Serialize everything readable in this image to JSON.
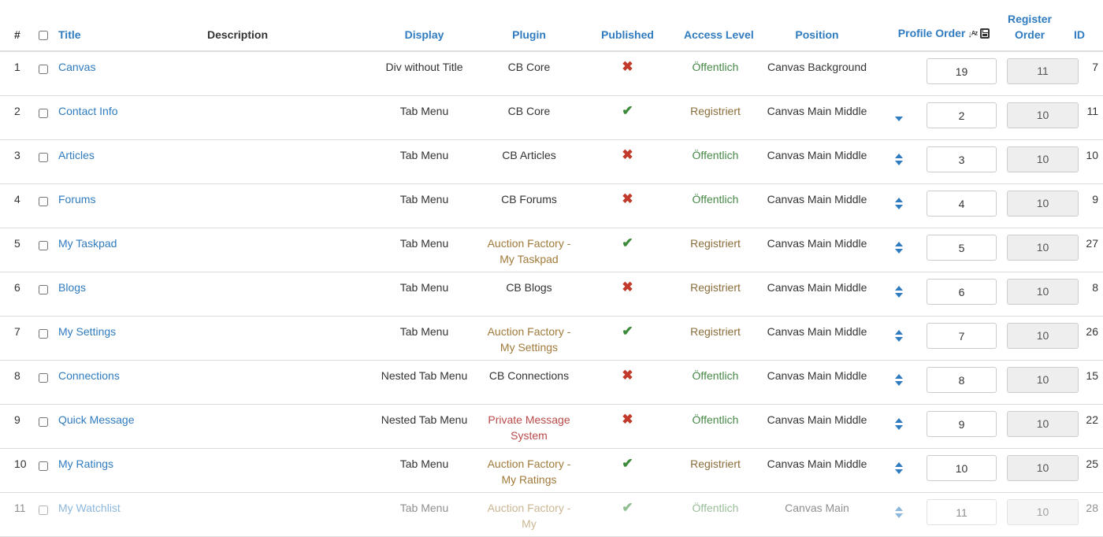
{
  "headers": {
    "num": "#",
    "title": "Title",
    "description": "Description",
    "display": "Display",
    "plugin": "Plugin",
    "published": "Published",
    "access": "Access Level",
    "position": "Position",
    "profile_order": "Profile Order",
    "register_order": "Register Order",
    "id": "ID"
  },
  "rows": [
    {
      "num": "1",
      "title": "Canvas",
      "display": "Div without Title",
      "plugin": "CB Core",
      "plugin_kind": "core",
      "published": false,
      "access": "Öffentlich",
      "access_kind": "pub",
      "position": "Canvas Background",
      "up": false,
      "down": false,
      "profile_order": "19",
      "register_order": "11",
      "id": "7"
    },
    {
      "num": "2",
      "title": "Contact Info",
      "display": "Tab Menu",
      "plugin": "CB Core",
      "plugin_kind": "core",
      "published": true,
      "access": "Registriert",
      "access_kind": "reg",
      "position": "Canvas Main Middle",
      "up": false,
      "down": true,
      "profile_order": "2",
      "register_order": "10",
      "id": "11"
    },
    {
      "num": "3",
      "title": "Articles",
      "display": "Tab Menu",
      "plugin": "CB Articles",
      "plugin_kind": "core",
      "published": false,
      "access": "Öffentlich",
      "access_kind": "pub",
      "position": "Canvas Main Middle",
      "up": true,
      "down": true,
      "profile_order": "3",
      "register_order": "10",
      "id": "10"
    },
    {
      "num": "4",
      "title": "Forums",
      "display": "Tab Menu",
      "plugin": "CB Forums",
      "plugin_kind": "core",
      "published": false,
      "access": "Öffentlich",
      "access_kind": "pub",
      "position": "Canvas Main Middle",
      "up": true,
      "down": true,
      "profile_order": "4",
      "register_order": "10",
      "id": "9"
    },
    {
      "num": "5",
      "title": "My Taskpad",
      "display": "Tab Menu",
      "plugin": "Auction Factory - My Taskpad",
      "plugin_kind": "af",
      "published": true,
      "access": "Registriert",
      "access_kind": "reg",
      "position": "Canvas Main Middle",
      "up": true,
      "down": true,
      "profile_order": "5",
      "register_order": "10",
      "id": "27"
    },
    {
      "num": "6",
      "title": "Blogs",
      "display": "Tab Menu",
      "plugin": "CB Blogs",
      "plugin_kind": "core",
      "published": false,
      "access": "Registriert",
      "access_kind": "reg",
      "position": "Canvas Main Middle",
      "up": true,
      "down": true,
      "profile_order": "6",
      "register_order": "10",
      "id": "8"
    },
    {
      "num": "7",
      "title": "My Settings",
      "display": "Tab Menu",
      "plugin": "Auction Factory - My Settings",
      "plugin_kind": "af",
      "published": true,
      "access": "Registriert",
      "access_kind": "reg",
      "position": "Canvas Main Middle",
      "up": true,
      "down": true,
      "profile_order": "7",
      "register_order": "10",
      "id": "26"
    },
    {
      "num": "8",
      "title": "Connections",
      "display": "Nested Tab Menu",
      "plugin": "CB Connections",
      "plugin_kind": "core",
      "published": false,
      "access": "Öffentlich",
      "access_kind": "pub",
      "position": "Canvas Main Middle",
      "up": true,
      "down": true,
      "profile_order": "8",
      "register_order": "10",
      "id": "15"
    },
    {
      "num": "9",
      "title": "Quick Message",
      "display": "Nested Tab Menu",
      "plugin": "Private Message System",
      "plugin_kind": "pm",
      "published": false,
      "access": "Öffentlich",
      "access_kind": "pub",
      "position": "Canvas Main Middle",
      "up": true,
      "down": true,
      "profile_order": "9",
      "register_order": "10",
      "id": "22"
    },
    {
      "num": "10",
      "title": "My Ratings",
      "display": "Tab Menu",
      "plugin": "Auction Factory - My Ratings",
      "plugin_kind": "af",
      "published": true,
      "access": "Registriert",
      "access_kind": "reg",
      "position": "Canvas Main Middle",
      "up": true,
      "down": true,
      "profile_order": "10",
      "register_order": "10",
      "id": "25"
    },
    {
      "num": "11",
      "title": "My Watchlist",
      "display": "Tab Menu",
      "plugin": "Auction Factory - My",
      "plugin_kind": "af",
      "published": true,
      "access": "Öffentlich",
      "access_kind": "pub",
      "position": "Canvas Main",
      "up": true,
      "down": true,
      "profile_order": "11",
      "register_order": "10",
      "id": "28"
    }
  ],
  "icons": {
    "published_yes": "check-icon",
    "published_no": "x-icon",
    "sort": "sort-alpha-icon",
    "save": "save-icon"
  },
  "colors": {
    "link": "#2f7bbf",
    "published": "#3a8a3a",
    "unpublished": "#c0392b",
    "access_public": "#468847",
    "access_registered": "#8a6d3b",
    "plugin_auction": "#a07a3a",
    "plugin_pm": "#b94a48"
  }
}
